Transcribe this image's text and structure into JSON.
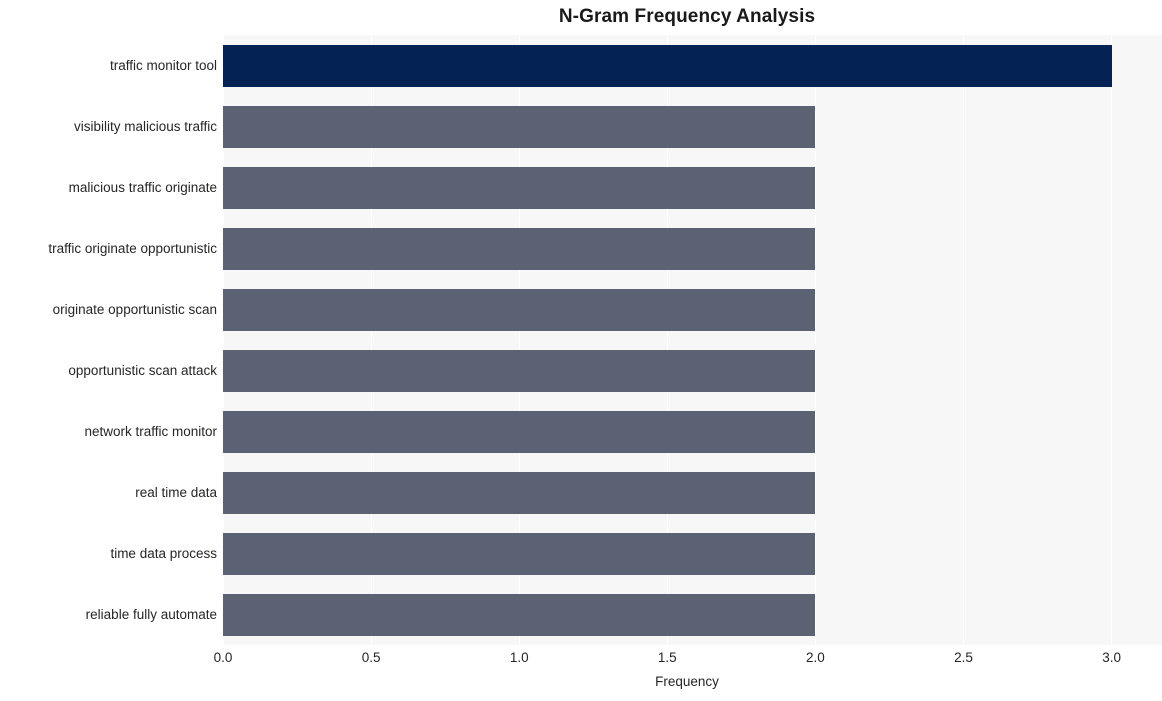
{
  "chart_data": {
    "type": "bar",
    "orientation": "horizontal",
    "title": "N-Gram Frequency Analysis",
    "xlabel": "Frequency",
    "ylabel": "",
    "categories": [
      "traffic monitor tool",
      "visibility malicious traffic",
      "malicious traffic originate",
      "traffic originate opportunistic",
      "originate opportunistic scan",
      "opportunistic scan attack",
      "network traffic monitor",
      "real time data",
      "time data process",
      "reliable fully automate"
    ],
    "values": [
      3,
      2,
      2,
      2,
      2,
      2,
      2,
      2,
      2,
      2
    ],
    "bar_colors": [
      "#042253",
      "#5a6274",
      "#5a6274",
      "#5a6274",
      "#5a6274",
      "#5a6274",
      "#5a6274",
      "#5a6274",
      "#5a6274",
      "#5a6274"
    ],
    "xlim": [
      0,
      3.17
    ],
    "ylim_categories": 10,
    "xticks": [
      0,
      0.5,
      1,
      1.5,
      2,
      2.5,
      3
    ],
    "xticklabels": [
      "0.0",
      "0.5",
      "1.0",
      "1.5",
      "2.0",
      "2.5",
      "3.0"
    ],
    "grid": true,
    "grid_axis": "x",
    "grid_color": "#ffffff",
    "legend": null,
    "legend_position": "none",
    "plot_background": "#f7f7f7",
    "figure_background": "#ffffff",
    "text_color": "#262626",
    "title_color": "#1a1a1a"
  }
}
